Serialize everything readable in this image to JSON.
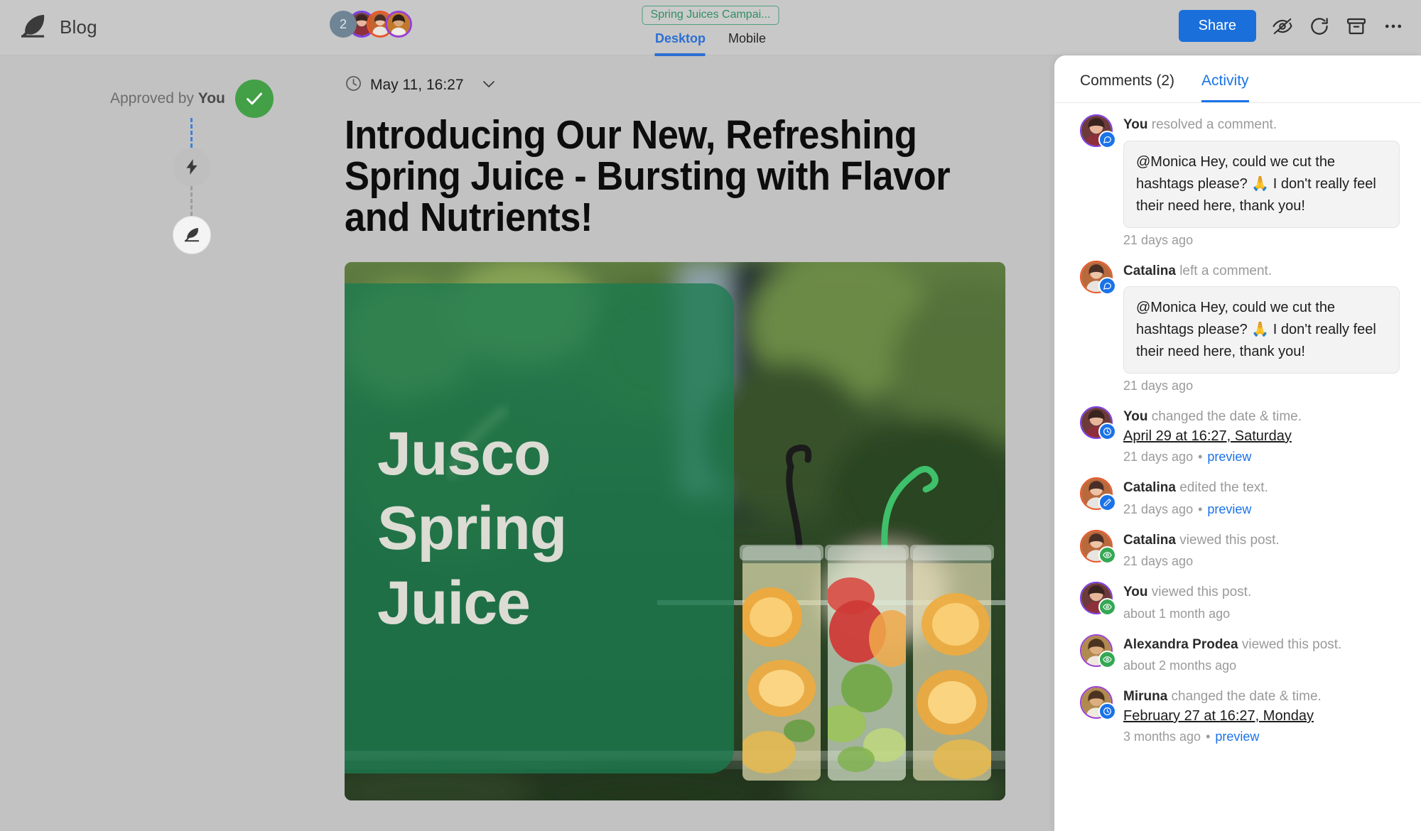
{
  "header": {
    "logo_icon": "feather-quill-icon",
    "title": "Blog",
    "collaborators": {
      "overflow_count": "2",
      "avatars": [
        {
          "name": "Monica",
          "ring_color": "#7b3fe4"
        },
        {
          "name": "Catalina",
          "ring_color": "#e8572a"
        },
        {
          "name": "Miruna",
          "ring_color": "#9a3fd4"
        }
      ]
    },
    "campaign_tag": "Spring Juices Campai...",
    "campaign_tag_color": "#2f8f63",
    "view_tabs": [
      {
        "label": "Desktop",
        "active": true
      },
      {
        "label": "Mobile",
        "active": false
      }
    ],
    "share_label": "Share",
    "actions": [
      {
        "icon": "eye-off-icon"
      },
      {
        "icon": "refresh-icon"
      },
      {
        "icon": "archive-icon"
      },
      {
        "icon": "more-horizontal-icon"
      }
    ],
    "accent_color": "#1a6fdb"
  },
  "approval": {
    "label_prefix": "Approved by ",
    "label_actor": "You",
    "nodes": [
      {
        "icon": "check-icon",
        "state": "approved",
        "color": "#43a047"
      },
      {
        "icon": "lightning-bolt-icon",
        "state": "automation",
        "color": "#bfbfbf"
      },
      {
        "icon": "feather-quill-icon",
        "state": "draft",
        "color": "#f4f4f4"
      }
    ],
    "connector_color": "#3b82d9"
  },
  "article": {
    "clock_icon": "clock-icon",
    "date": "May 11, 16:27",
    "chevron_icon": "chevron-down-icon",
    "title": "Introducing Our New, Refreshing Spring Juice - Bursting with Flavor and Nutrients!",
    "hero": {
      "alt": "Mason jars of fruit-infused spring water on a ledge with blurred green foliage background",
      "overlay_lines": [
        "Jusco",
        "Spring",
        "Juice"
      ],
      "overlay_color": "#1b7b50"
    }
  },
  "side_panel": {
    "tabs": [
      {
        "label": "Comments (2)",
        "active": false
      },
      {
        "label": "Activity",
        "active": true
      }
    ],
    "activity": [
      {
        "actor": "You",
        "action": " resolved a comment.",
        "badge_icon": "comment-bubble-icon",
        "badge_color": "#1a73e8",
        "ring_color": "#7b3fe4",
        "comment": "@Monica Hey, could we cut the hashtags please? 🙏 I don't really feel their need here, thank you!",
        "detail": null,
        "time": "21 days ago",
        "preview": null
      },
      {
        "actor": "Catalina",
        "action": " left a comment.",
        "badge_icon": "comment-bubble-icon",
        "badge_color": "#1a73e8",
        "ring_color": "#e8572a",
        "comment": "@Monica Hey, could we cut the hashtags please? 🙏 I don't really feel their need here, thank you!",
        "detail": null,
        "time": "21 days ago",
        "preview": null
      },
      {
        "actor": "You",
        "action": " changed the date & time.",
        "badge_icon": "clock-icon",
        "badge_color": "#1a73e8",
        "ring_color": "#7b3fe4",
        "comment": null,
        "detail": "April 29 at 16:27, Saturday",
        "time": "21 days ago",
        "preview": "preview"
      },
      {
        "actor": "Catalina",
        "action": " edited the text.",
        "badge_icon": "pencil-icon",
        "badge_color": "#1a73e8",
        "ring_color": "#e8572a",
        "comment": null,
        "detail": null,
        "time": "21 days ago",
        "preview": "preview"
      },
      {
        "actor": "Catalina",
        "action": " viewed this post.",
        "badge_icon": "eye-icon",
        "badge_color": "#34a853",
        "ring_color": "#e8572a",
        "comment": null,
        "detail": null,
        "time": "21 days ago",
        "preview": null
      },
      {
        "actor": "You",
        "action": " viewed this post.",
        "badge_icon": "eye-icon",
        "badge_color": "#34a853",
        "ring_color": "#7b3fe4",
        "comment": null,
        "detail": null,
        "time": "about 1 month ago",
        "preview": null
      },
      {
        "actor": "Alexandra Prodea",
        "action": " viewed this post.",
        "badge_icon": "eye-icon",
        "badge_color": "#34a853",
        "ring_color": "#9a3fd4",
        "comment": null,
        "detail": null,
        "time": "about 2 months ago",
        "preview": null
      },
      {
        "actor": "Miruna",
        "action": " changed the date & time.",
        "badge_icon": "clock-icon",
        "badge_color": "#1a73e8",
        "ring_color": "#9a3fd4",
        "comment": null,
        "detail": "February 27 at 16:27, Monday",
        "time": "3 months ago",
        "preview": "preview"
      }
    ]
  }
}
